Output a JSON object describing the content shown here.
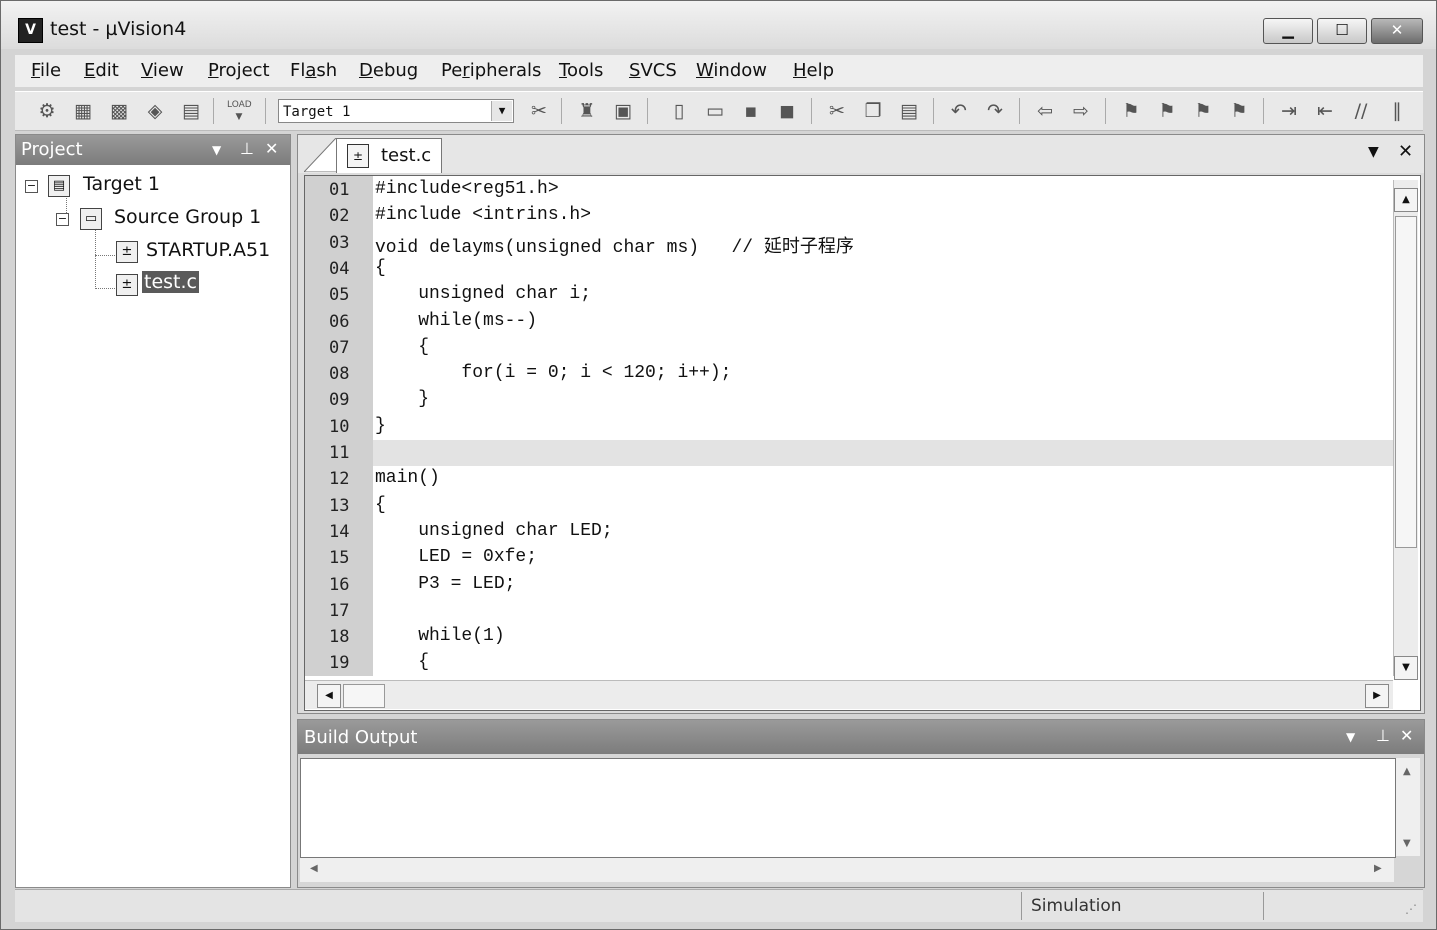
{
  "window": {
    "title": "test  - µVision4",
    "icon_glyph": "V"
  },
  "menu": [
    "File",
    "Edit",
    "View",
    "Project",
    "Flash",
    "Debug",
    "Peripherals",
    "Tools",
    "SVCS",
    "Window",
    "Help"
  ],
  "toolbar": {
    "target_value": "Target 1",
    "load_label": "LOAD"
  },
  "project_panel": {
    "title": "Project",
    "tree": {
      "target": "Target 1",
      "group": "Source Group 1",
      "files": [
        "STARTUP.A51",
        "test.c"
      ]
    }
  },
  "editor": {
    "tab_label": "test.c",
    "line_numbers": [
      "01",
      "02",
      "03",
      "04",
      "05",
      "06",
      "07",
      "08",
      "09",
      "10",
      "11",
      "12",
      "13",
      "14",
      "15",
      "16",
      "17",
      "18",
      "19"
    ],
    "lines": [
      "#include<reg51.h>",
      "#include <intrins.h>",
      "void delayms(unsigned char ms)   // 延时子程序",
      "{",
      "    unsigned char i;",
      "    while(ms--)",
      "    {",
      "        for(i = 0; i < 120; i++);",
      "    }",
      "}",
      "",
      "main()",
      "{",
      "    unsigned char LED;",
      "    LED = 0xfe;",
      "    P3 = LED;",
      "",
      "    while(1)",
      "    {"
    ],
    "current_line": "11"
  },
  "build_output": {
    "title": "Build Output"
  },
  "status": {
    "mode": "Simulation"
  }
}
